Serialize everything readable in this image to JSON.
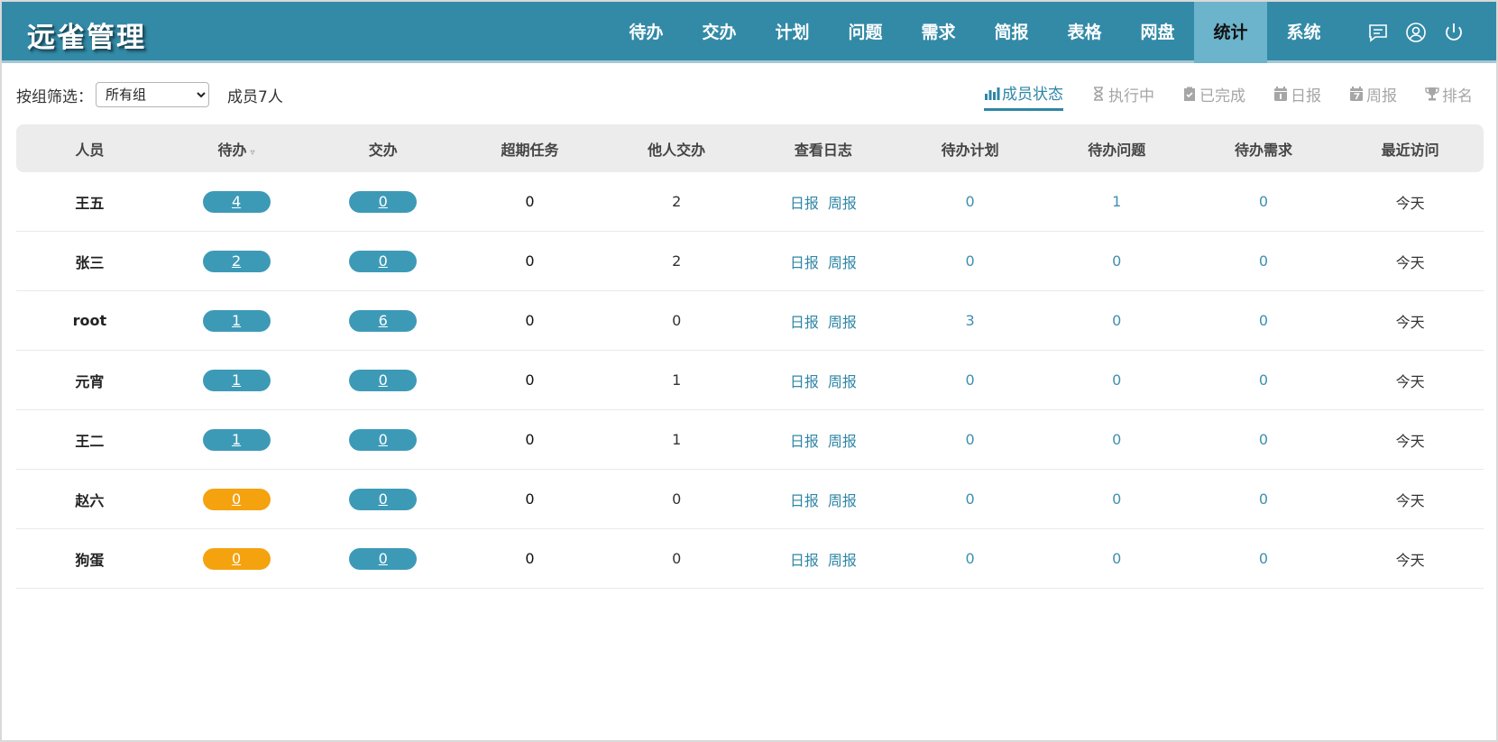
{
  "app": {
    "title": "远雀管理"
  },
  "nav": [
    {
      "label": "待办"
    },
    {
      "label": "交办"
    },
    {
      "label": "计划"
    },
    {
      "label": "问题"
    },
    {
      "label": "需求"
    },
    {
      "label": "简报"
    },
    {
      "label": "表格"
    },
    {
      "label": "网盘"
    },
    {
      "label": "统计",
      "active": true
    },
    {
      "label": "系统"
    }
  ],
  "top_icons": [
    "message-icon",
    "user-icon",
    "power-icon"
  ],
  "filter": {
    "label": "按组筛选：",
    "selected": "所有组",
    "member_count": "成员7人"
  },
  "tabs": [
    {
      "label": "成员状态",
      "icon": "bar-chart-icon",
      "active": true
    },
    {
      "label": "执行中",
      "icon": "hourglass-icon"
    },
    {
      "label": "已完成",
      "icon": "clipboard-check-icon"
    },
    {
      "label": "日报",
      "icon": "calendar-day-icon"
    },
    {
      "label": "周报",
      "icon": "calendar-week-icon"
    },
    {
      "label": "排名",
      "icon": "trophy-icon"
    }
  ],
  "table": {
    "sort_marker": "▿",
    "columns": [
      "人员",
      "待办",
      "交办",
      "超期任务",
      "他人交办",
      "查看日志",
      "待办计划",
      "待办问题",
      "待办需求",
      "最近访问"
    ],
    "log_links": [
      "日报",
      "周报"
    ],
    "rows": [
      {
        "name": "王五",
        "todo": "4",
        "todo_status": "normal",
        "assigned": "0",
        "overdue": "0",
        "by_others": "2",
        "plans": "0",
        "issues": "1",
        "requirements": "0",
        "last_visit": "今天"
      },
      {
        "name": "张三",
        "todo": "2",
        "todo_status": "normal",
        "assigned": "0",
        "overdue": "0",
        "by_others": "2",
        "plans": "0",
        "issues": "0",
        "requirements": "0",
        "last_visit": "今天"
      },
      {
        "name": "root",
        "todo": "1",
        "todo_status": "normal",
        "assigned": "6",
        "overdue": "0",
        "by_others": "0",
        "plans": "3",
        "issues": "0",
        "requirements": "0",
        "last_visit": "今天"
      },
      {
        "name": "元宵",
        "todo": "1",
        "todo_status": "normal",
        "assigned": "0",
        "overdue": "0",
        "by_others": "1",
        "plans": "0",
        "issues": "0",
        "requirements": "0",
        "last_visit": "今天"
      },
      {
        "name": "王二",
        "todo": "1",
        "todo_status": "normal",
        "assigned": "0",
        "overdue": "0",
        "by_others": "1",
        "plans": "0",
        "issues": "0",
        "requirements": "0",
        "last_visit": "今天"
      },
      {
        "name": "赵六",
        "todo": "0",
        "todo_status": "warning",
        "assigned": "0",
        "overdue": "0",
        "by_others": "0",
        "plans": "0",
        "issues": "0",
        "requirements": "0",
        "last_visit": "今天"
      },
      {
        "name": "狗蛋",
        "todo": "0",
        "todo_status": "warning",
        "assigned": "0",
        "overdue": "0",
        "by_others": "0",
        "plans": "0",
        "issues": "0",
        "requirements": "0",
        "last_visit": "今天"
      }
    ]
  },
  "colors": {
    "header": "#338aa7",
    "accent": "#2f86a6",
    "pill": "#3d9ab7",
    "pill_warning": "#f5a20f"
  }
}
